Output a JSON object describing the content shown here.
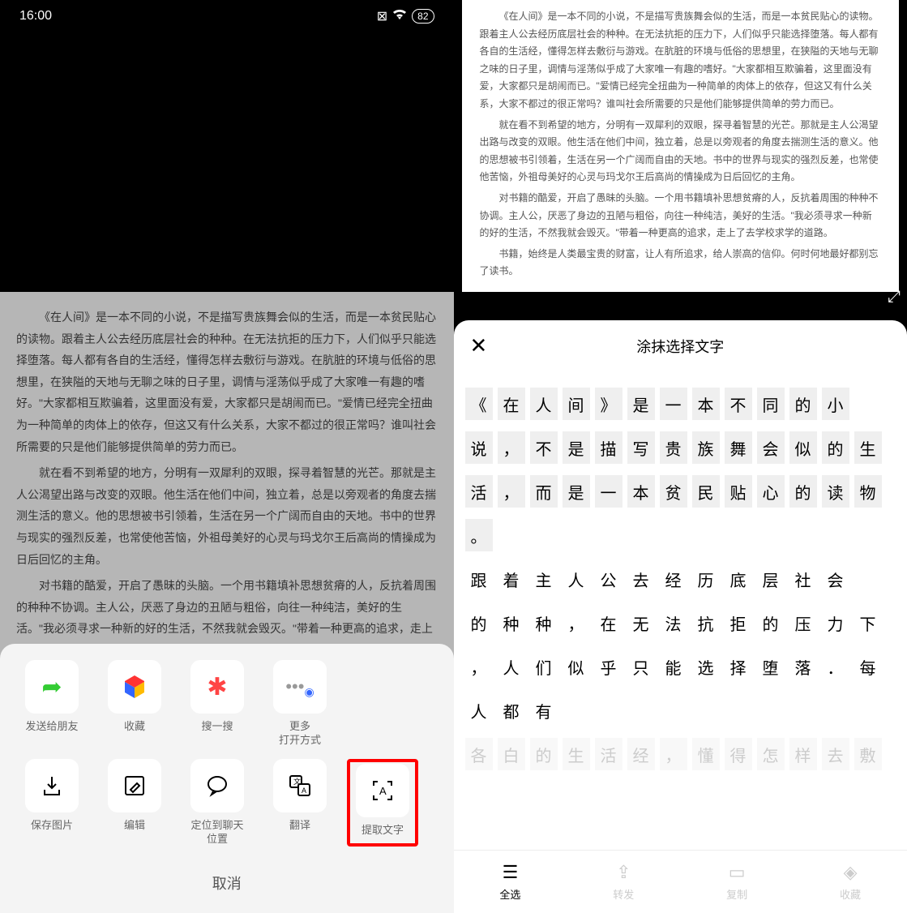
{
  "status": {
    "time": "16:00",
    "battery": "82"
  },
  "article": {
    "p1": "《在人间》是一本不同的小说，不是描写贵族舞会似的生活，而是一本贫民贴心的读物。跟着主人公去经历底层社会的种种。在无法抗拒的压力下，人们似乎只能选择堕落。每人都有各自的生活经，懂得怎样去敷衍与游戏。在肮脏的环境与低俗的思想里，在狭隘的天地与无聊之味的日子里，调情与淫荡似乎成了大家唯一有趣的嗜好。\"大家都相互欺骗着，这里面没有爱，大家都只是胡闹而已。\"爱情已经完全扭曲为一种简单的肉体上的依存，但这又有什么关系，大家不都过的很正常吗？谁叫社会所需要的只是他们能够提供简单的劳力而已。",
    "p2": "就在看不到希望的地方，分明有一双犀利的双眼，探寻着智慧的光芒。那就是主人公渴望出路与改变的双眼。他生活在他们中间，独立着，总是以旁观者的角度去揣测生活的意义。他的思想被书引领着，生活在另一个广阔而自由的天地。书中的世界与现实的强烈反差，也常使他苦恼，外祖母美好的心灵与玛戈尔王后高尚的情操成为日后回忆的主角。",
    "p3": "对书籍的酷爱，开启了愚昧的头脑。一个用书籍填补思想贫瘠的人，反抗着周围的种种不协调。主人公，厌恶了身边的丑陋与粗俗，向往一种纯洁，美好的生活。\"我必须寻求一种新的好的生活，不然我就会毁灭。\"带着一种更高的追求，走上了去学校求学的道路。",
    "p4": "书籍，始终是人类最宝贵的财富，让人有所追求，给人崇高的信仰。何时何地最好都别忘了读书。"
  },
  "left_sheet": {
    "row1": [
      {
        "label": "发送给朋友"
      },
      {
        "label": "收藏"
      },
      {
        "label": "搜一搜"
      },
      {
        "label": "更多\n打开方式"
      }
    ],
    "row2": [
      {
        "label": "保存图片"
      },
      {
        "label": "编辑"
      },
      {
        "label": "定位到聊天\n位置"
      },
      {
        "label": "翻译"
      },
      {
        "label": "提取文字"
      }
    ],
    "cancel": "取消"
  },
  "right_sheet": {
    "title": "涂抹选择文字",
    "lines": [
      [
        "《",
        "在",
        "人",
        "间",
        "》",
        "是",
        "一",
        "本",
        "不",
        "同",
        "的",
        "小"
      ],
      [
        "说",
        "，",
        "不",
        "是",
        "描",
        "写",
        "贵",
        "族",
        "舞",
        "会",
        "似",
        "的",
        "生"
      ],
      [
        "活",
        "，",
        "而",
        "是",
        "一",
        "本",
        "贫",
        "民",
        "贴",
        "心",
        "的",
        "读",
        "物"
      ],
      [
        "。"
      ]
    ],
    "lines_plain": [
      [
        "跟",
        "着",
        "主",
        "人",
        "公",
        "去",
        "经",
        "历",
        "底",
        "层",
        "社",
        "会"
      ],
      [
        "的",
        "种",
        "种",
        "，",
        "在",
        "无",
        "法",
        "抗",
        "拒",
        "的",
        "压",
        "力",
        "下"
      ],
      [
        "，",
        "人",
        "们",
        "似",
        "乎",
        "只",
        "能",
        "选",
        "择",
        "堕",
        "落",
        "．",
        "每"
      ],
      [
        "人",
        "都",
        "有"
      ]
    ],
    "lines_faded": [
      [
        "各",
        "白",
        "的",
        "生",
        "活",
        "经",
        "，",
        "懂",
        "得",
        "怎",
        "样",
        "去",
        "敷"
      ]
    ],
    "bottom_bar": [
      {
        "label": "全选",
        "active": true
      },
      {
        "label": "转发",
        "active": false
      },
      {
        "label": "复制",
        "active": false
      },
      {
        "label": "收藏",
        "active": false
      }
    ]
  }
}
